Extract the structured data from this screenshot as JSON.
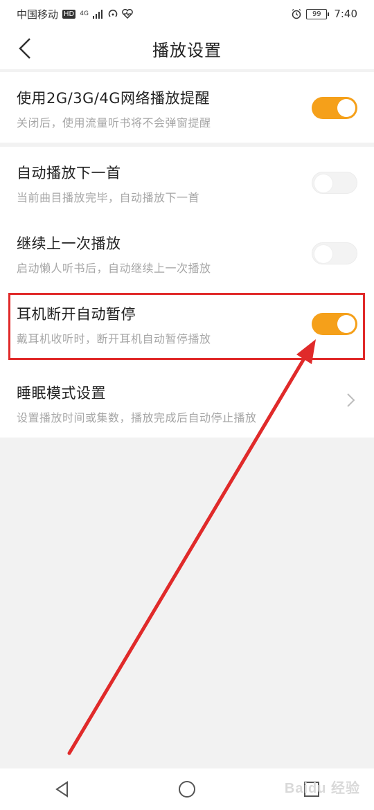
{
  "status_bar": {
    "carrier": "中国移动",
    "hd_badge": "HD",
    "network": "4G",
    "battery": "99",
    "time": "7:40",
    "icons": [
      "hd-icon",
      "signal-icon",
      "hotspot-icon",
      "health-heart-icon",
      "alarm-icon",
      "battery-icon"
    ]
  },
  "header": {
    "title": "播放设置",
    "back_icon": "chevron-left-icon"
  },
  "settings": [
    {
      "title": "使用2G/3G/4G网络播放提醒",
      "subtitle": "关闭后，使用流量听书将不会弹窗提醒",
      "control": "toggle",
      "state": "on"
    },
    {
      "title": "自动播放下一首",
      "subtitle": "当前曲目播放完毕，自动播放下一首",
      "control": "toggle",
      "state": "off"
    },
    {
      "title": "继续上一次播放",
      "subtitle": "启动懒人听书后，自动继续上一次播放",
      "control": "toggle",
      "state": "off"
    },
    {
      "title": "耳机断开自动暂停",
      "subtitle": "戴耳机收听时，断开耳机自动暂停播放",
      "control": "toggle",
      "state": "on"
    },
    {
      "title": "睡眠模式设置",
      "subtitle": "设置播放时间或集数，播放完成后自动停止播放",
      "control": "chevron",
      "state": ""
    }
  ],
  "annotation": {
    "highlight_color": "#e02a2a",
    "arrow_color": "#e02a2a"
  },
  "navbar": {
    "icons": [
      "nav-back-icon",
      "nav-home-icon",
      "nav-recents-icon"
    ]
  },
  "watermark": "Baidu 经验",
  "colors": {
    "accent": "#f5a01a",
    "background": "#f2f2f2",
    "card": "#ffffff",
    "subtitle": "#a6a6a6"
  }
}
